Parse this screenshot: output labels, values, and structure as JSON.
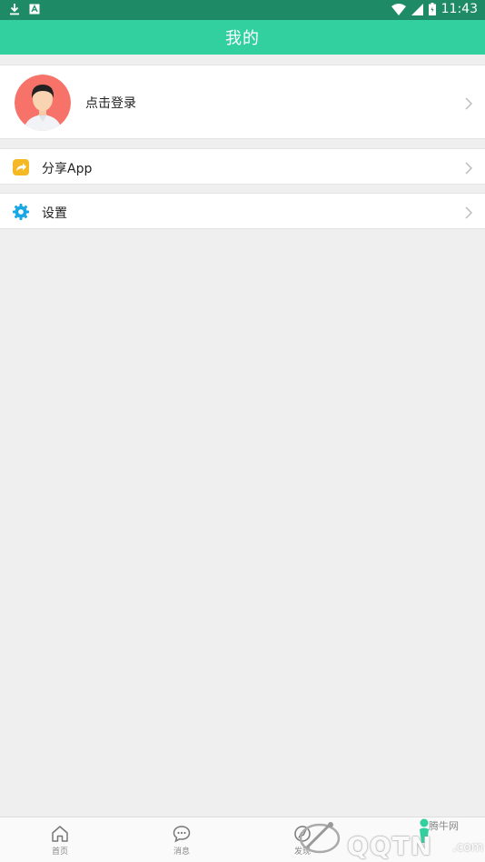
{
  "status_bar": {
    "time": "11:43"
  },
  "app_bar": {
    "title": "我的"
  },
  "profile": {
    "login_text": "点击登录"
  },
  "menu": {
    "share_label": "分享App",
    "settings_label": "设置"
  },
  "bottom_nav": {
    "items": [
      {
        "label": "首页",
        "icon": "home-icon"
      },
      {
        "label": "消息",
        "icon": "message-icon"
      },
      {
        "label": "发现",
        "icon": "discover-icon"
      }
    ]
  },
  "watermark": {
    "cn": "腾牛网",
    "en": "QQTN",
    "com": ".com"
  },
  "colors": {
    "status_bar": "#1e8a66",
    "app_bar": "#32cf9f",
    "share_icon": "#f4b925",
    "settings_icon": "#1aa7e6",
    "avatar_bg": "#f7736a"
  }
}
